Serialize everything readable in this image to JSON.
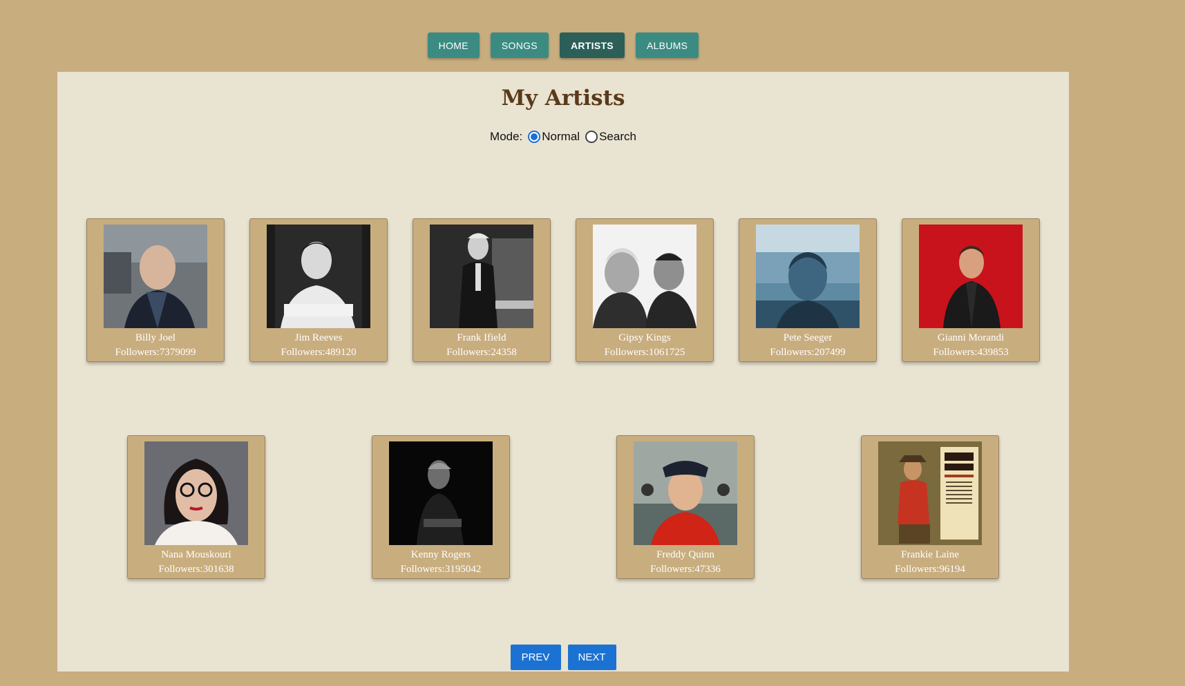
{
  "nav": {
    "items": [
      {
        "label": "HOME",
        "active": false
      },
      {
        "label": "SONGS",
        "active": false
      },
      {
        "label": "ARTISTS",
        "active": true
      },
      {
        "label": "ALBUMS",
        "active": false
      }
    ]
  },
  "page": {
    "title": "My Artists",
    "mode_label": "Mode:",
    "mode_options": [
      {
        "label": "Normal",
        "checked": true
      },
      {
        "label": "Search",
        "checked": false
      }
    ]
  },
  "artists": [
    {
      "name": "Billy Joel",
      "followers": "Followers:7379099"
    },
    {
      "name": "Jim Reeves",
      "followers": "Followers:489120"
    },
    {
      "name": "Frank Ifield",
      "followers": "Followers:24358"
    },
    {
      "name": "Gipsy Kings",
      "followers": "Followers:1061725"
    },
    {
      "name": "Pete Seeger",
      "followers": "Followers:207499"
    },
    {
      "name": "Gianni Morandi",
      "followers": "Followers:439853"
    },
    {
      "name": "Nana Mouskouri",
      "followers": "Followers:301638"
    },
    {
      "name": "Kenny Rogers",
      "followers": "Followers:3195042"
    },
    {
      "name": "Freddy Quinn",
      "followers": "Followers:47336"
    },
    {
      "name": "Frankie Laine",
      "followers": "Followers:96194"
    }
  ],
  "pager": {
    "prev_label": "PREV",
    "next_label": "NEXT"
  },
  "colors": {
    "teal": "#3b8b82",
    "teal_active": "#2c5f58",
    "tan": "#c8ad7f",
    "panel": "#e9e3d2",
    "blue": "#1b72d2"
  }
}
